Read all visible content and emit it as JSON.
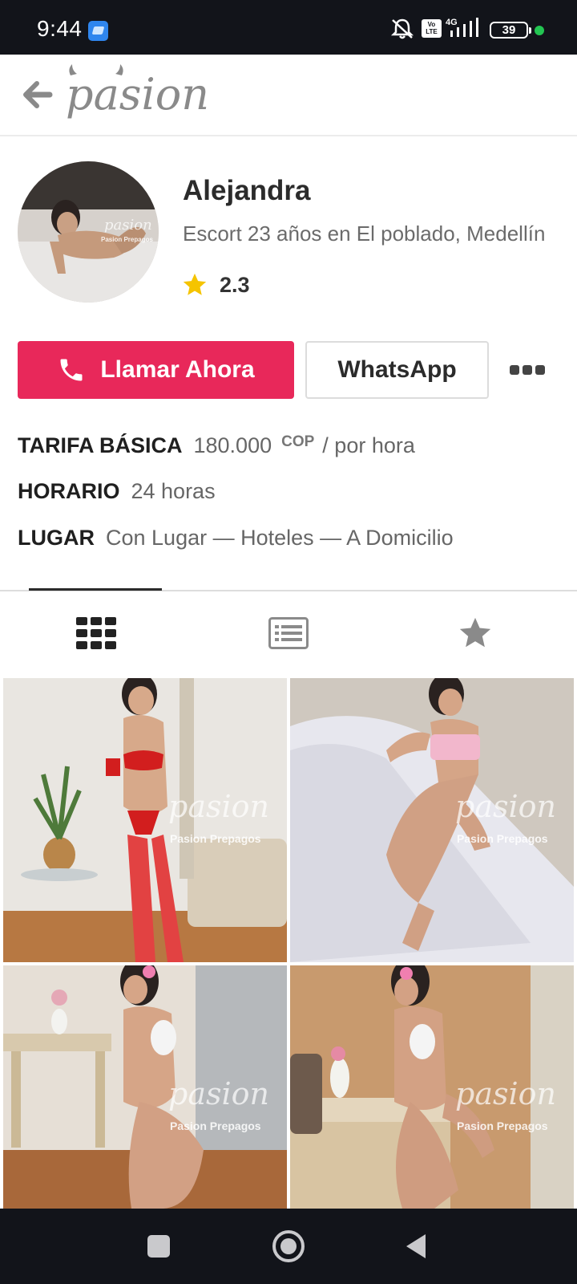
{
  "status_bar": {
    "time": "9:44",
    "network_label": "4G",
    "volte_label": "Vo LTE",
    "battery_level": "39",
    "icons": [
      "app-icon",
      "mute-icon",
      "volte-icon",
      "signal-icon",
      "battery-icon"
    ]
  },
  "header": {
    "back_icon": "arrow-left-icon",
    "logo_text": "pasion"
  },
  "profile": {
    "name": "Alejandra",
    "subtitle": "Escort 23 años en El poblado, Medellín",
    "rating": "2.3",
    "avatar_watermark": "pasion",
    "avatar_caption": "Pasion Prepagos"
  },
  "actions": {
    "call_label": "Llamar Ahora",
    "whatsapp_label": "WhatsApp",
    "call_color": "#e8285a"
  },
  "info": {
    "rate_label": "TARIFA BÁSICA",
    "rate_value": "180.000",
    "rate_currency": "COP",
    "rate_unit": "/ por hora",
    "schedule_label": "HORARIO",
    "schedule_value": "24 horas",
    "place_label": "LUGAR",
    "place_value": "Con Lugar — Hoteles — A Domicilio"
  },
  "tabs": [
    {
      "icon": "grid-icon",
      "active": true
    },
    {
      "icon": "list-icon",
      "active": false
    },
    {
      "icon": "star-icon",
      "active": false
    }
  ],
  "gallery": {
    "watermark_logo": "pasion",
    "watermark_caption": "Pasion Prepagos"
  },
  "nav": {
    "icons": [
      "recents-square-icon",
      "home-circle-icon",
      "back-triangle-icon"
    ]
  }
}
